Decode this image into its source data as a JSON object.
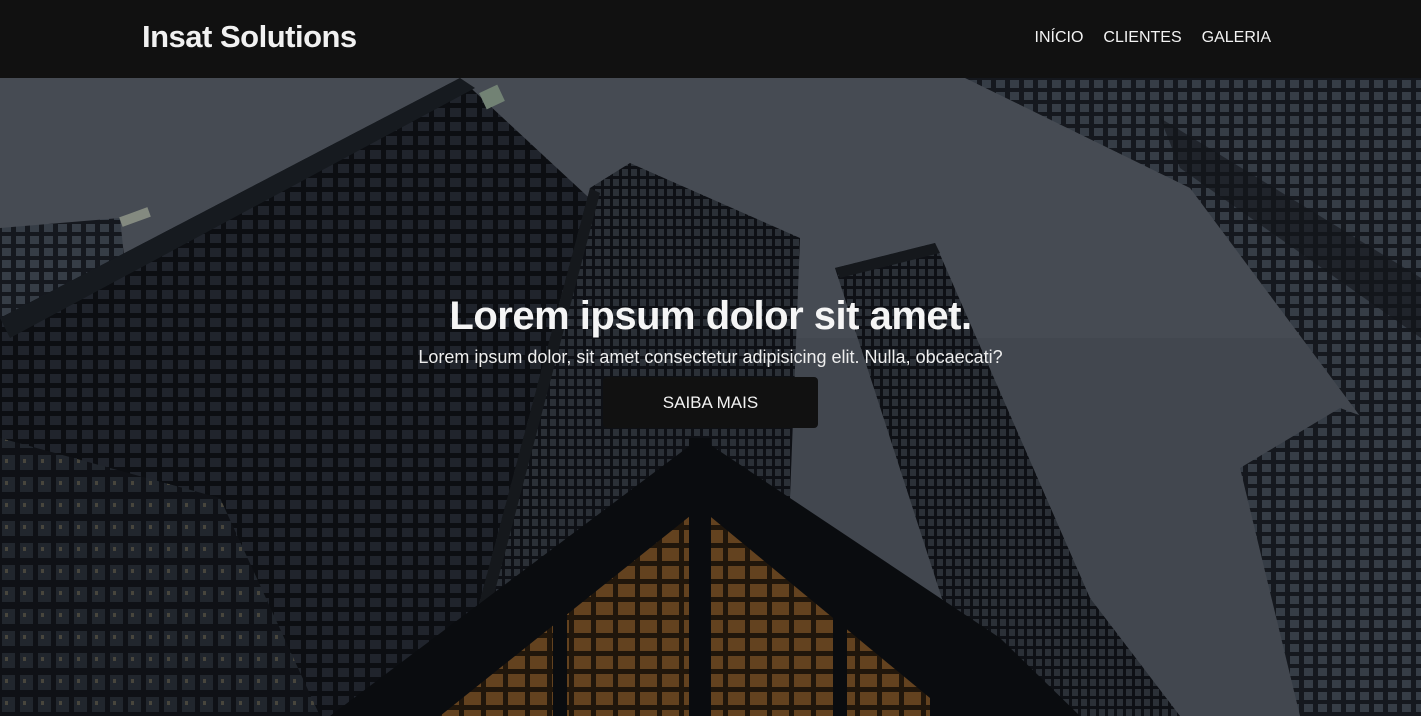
{
  "navbar": {
    "brand": "Insat Solutions",
    "links": [
      "INÍCIO",
      "CLIENTES",
      "GALERIA"
    ]
  },
  "hero": {
    "title": "Lorem ipsum dolor sit amet.",
    "subtitle": "Lorem ipsum dolor, sit amet consectetur adipisicing elit. Nulla, obcaecati?",
    "button_label": "SAIBA MAIS",
    "background_image": "skyscrapers-looking-up-photo"
  },
  "colors": {
    "navbar_bg": "#111111",
    "button_bg": "#111111",
    "text": "#f5f5f5"
  }
}
